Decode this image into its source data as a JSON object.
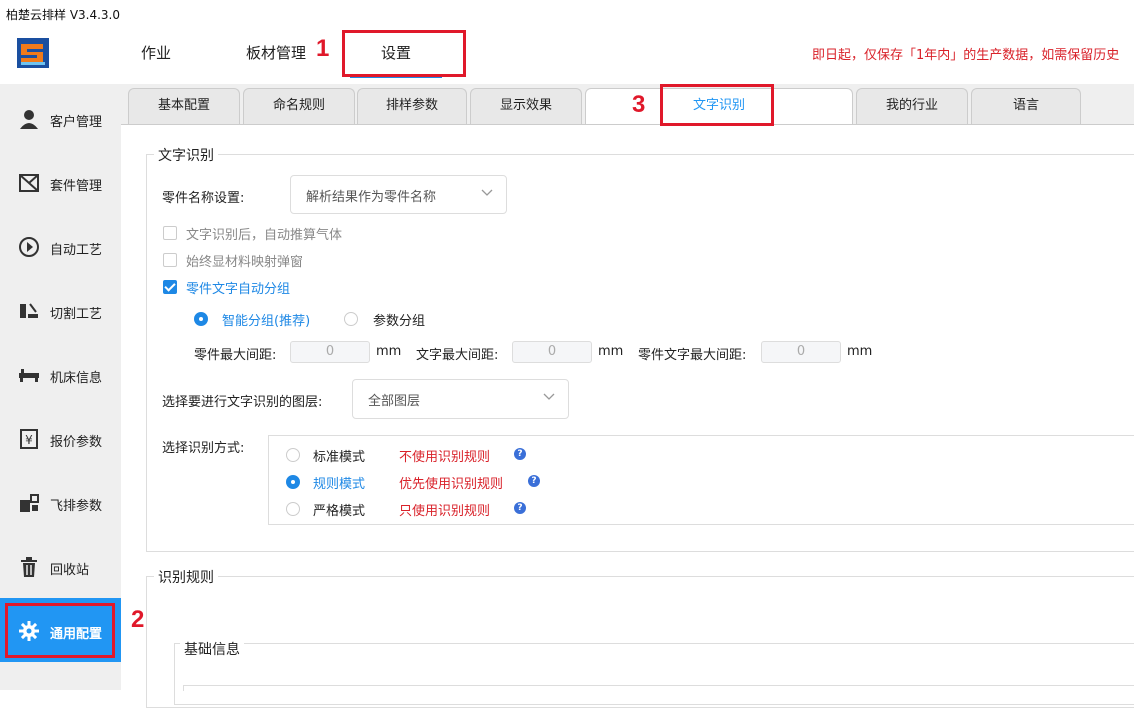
{
  "app": {
    "title": "柏楚云排样 V3.4.3.0"
  },
  "topnav": {
    "items": [
      {
        "label": "作业"
      },
      {
        "label": "板材管理"
      },
      {
        "label": "设置"
      }
    ],
    "notice": "即日起，仅保存「1年内」的生产数据，如需保留历史"
  },
  "sidebar": {
    "items": [
      {
        "label": "客户管理",
        "icon": "user-icon"
      },
      {
        "label": "套件管理",
        "icon": "kit-icon"
      },
      {
        "label": "自动工艺",
        "icon": "play-circle-icon"
      },
      {
        "label": "切割工艺",
        "icon": "cut-icon"
      },
      {
        "label": "机床信息",
        "icon": "machine-icon"
      },
      {
        "label": "报价参数",
        "icon": "price-icon"
      },
      {
        "label": "飞排参数",
        "icon": "fly-icon"
      },
      {
        "label": "回收站",
        "icon": "trash-icon"
      },
      {
        "label": "通用配置",
        "icon": "gear-icon"
      }
    ]
  },
  "tabs": [
    {
      "label": "基本配置"
    },
    {
      "label": "命名规则"
    },
    {
      "label": "排样参数"
    },
    {
      "label": "显示效果"
    },
    {
      "label": "文字识别"
    },
    {
      "label": "我的行业"
    },
    {
      "label": "语言"
    }
  ],
  "ocr": {
    "group_title": "文字识别",
    "part_name_label": "零件名称设置:",
    "part_name_value": "解析结果作为零件名称",
    "cb_auto_gas": {
      "label": "文字识别后，自动推算气体",
      "checked": false
    },
    "cb_always_popup": {
      "label": "始终显材料映射弹窗",
      "checked": false
    },
    "cb_auto_group": {
      "label": "零件文字自动分组",
      "checked": true
    },
    "radio_smart": {
      "label": "智能分组(推荐)",
      "selected": true
    },
    "radio_param": {
      "label": "参数分组",
      "selected": false
    },
    "part_max_gap_label": "零件最大间距:",
    "part_max_gap_value": "0",
    "text_max_gap_label": "文字最大间距:",
    "text_max_gap_value": "0",
    "part_text_max_gap_label": "零件文字最大间距:",
    "part_text_max_gap_value": "0",
    "unit": "mm",
    "layer_label": "选择要进行文字识别的图层:",
    "layer_value": "全部图层",
    "mode_label": "选择识别方式:",
    "modes": [
      {
        "label": "标准模式",
        "desc": "不使用识别规则",
        "selected": false
      },
      {
        "label": "规则模式",
        "desc": "优先使用识别规则",
        "selected": true
      },
      {
        "label": "严格模式",
        "desc": "只使用识别规则",
        "selected": false
      }
    ],
    "help_glyph": "?"
  },
  "rules": {
    "group_title": "识别规则",
    "sub_title": "基础信息"
  },
  "annotations": {
    "one": "1",
    "two": "2",
    "three": "3"
  },
  "colors": {
    "accent": "#2196f3",
    "warning": "#d9222a",
    "annotation": "#e0182a"
  }
}
